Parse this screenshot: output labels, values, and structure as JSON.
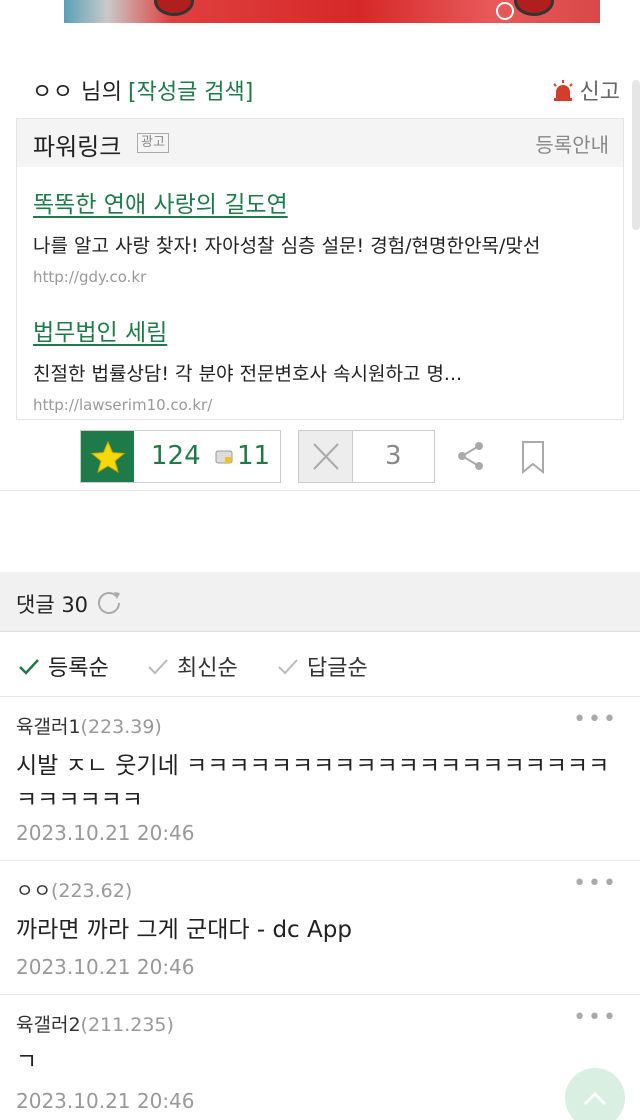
{
  "post": {
    "author_name": "ㅇㅇ 님의",
    "author_search": "[작성글 검색]",
    "report_label": "신고"
  },
  "powerlink": {
    "title": "파워링크",
    "ad_badge": "광고",
    "register_label": "등록안내",
    "ads": [
      {
        "title": "똑똑한 연애 사랑의 길도연",
        "desc": "나를 알고 사랑 찾자! 자아성찰 심층 설문! 경험/현명한안목/맞선",
        "url": "http://gdy.co.kr"
      },
      {
        "title": "법무법인 세림",
        "desc": "친절한 법률상담! 각 분야 전문변호사 속시원하고 명...",
        "url": "http://lawserim10.co.kr/"
      }
    ]
  },
  "reactions": {
    "recommend_count": "124",
    "fix_count": "11",
    "nonrecommend_count": "3"
  },
  "comments_header": {
    "label": "댓글 30"
  },
  "sort": {
    "options": [
      "등록순",
      "최신순",
      "답글순"
    ],
    "selected": "등록순"
  },
  "comments": [
    {
      "nick": "육갤러1",
      "ip": "(223.39)",
      "text": "시발 ㅈㄴ 웃기네 ㅋㅋㅋㅋㅋㅋㅋㅋㅋㅋㅋㅋㅋㅋㅋㅋㅋㅋㅋㅋㅋㅋㅋㅋㅋㅋ",
      "date": "2023.10.21 20:46"
    },
    {
      "nick": "ㅇㅇ",
      "ip": "(223.62)",
      "text": "까라면 까라 그게 군대다 - dc App",
      "date": "2023.10.21 20:46"
    },
    {
      "nick": "육갤러2",
      "ip": "(211.235)",
      "text": "ㄱ",
      "date": "2023.10.21 20:46"
    }
  ],
  "colors": {
    "accent_green": "#1f7a4a",
    "report_red": "#d43c2c"
  }
}
